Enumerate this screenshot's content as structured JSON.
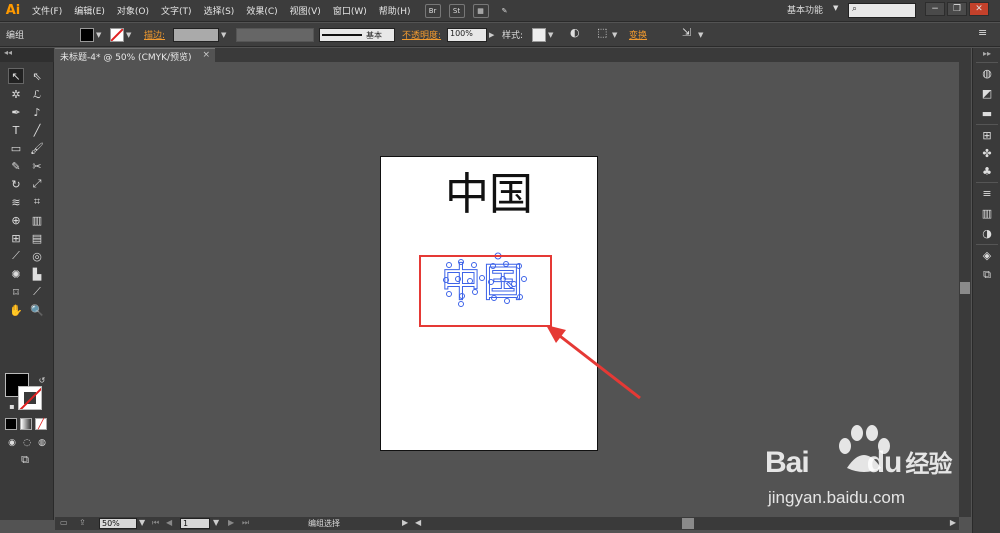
{
  "app": {
    "logo": "Ai"
  },
  "menu": [
    "文件(F)",
    "编辑(E)",
    "对象(O)",
    "文字(T)",
    "选择(S)",
    "效果(C)",
    "视图(V)",
    "窗口(W)",
    "帮助(H)"
  ],
  "menubar_icons": [
    "bridge-icon",
    "stock-icon",
    "arrange-icon",
    "brush-icon"
  ],
  "workspace": {
    "label": "基本功能",
    "search_placeholder": ""
  },
  "window_buttons": [
    "−",
    "❐",
    "✕"
  ],
  "control_bar": {
    "selection_label": "编组",
    "stroke_label": "描边:",
    "line_style": "基本",
    "opacity_label": "不透明度:",
    "opacity_value": "100%",
    "style_label": "样式:",
    "transform_label": "变换"
  },
  "document": {
    "tab_title": "未标题-4* @ 50% (CMYK/预览)",
    "close": "×"
  },
  "artboard": {
    "title_text": "中国",
    "outlined_text": "中国"
  },
  "status_bar": {
    "zoom": "50%",
    "page": "1",
    "status": "编组选择"
  },
  "colors": {
    "accent": "#f29a2e",
    "selection": "#3d63e8",
    "highlight": "#e53935"
  },
  "watermark": {
    "brand": "Bai",
    "brand_cn": "经验",
    "url": "jingyan.baidu.com"
  }
}
